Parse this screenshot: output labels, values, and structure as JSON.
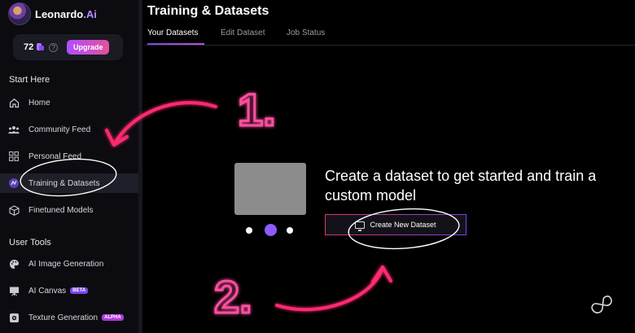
{
  "brand": {
    "name": "Leonardo",
    "suffix": ".Ai"
  },
  "tokens": {
    "count": "72",
    "upgrade_label": "Upgrade"
  },
  "sidebar": {
    "sections": [
      "Start Here",
      "User Tools"
    ],
    "items": [
      {
        "label": "Home",
        "icon": "home-icon"
      },
      {
        "label": "Community Feed",
        "icon": "community-icon"
      },
      {
        "label": "Personal Feed",
        "icon": "grid-icon"
      },
      {
        "label": "Training & Datasets",
        "icon": "training-icon",
        "active": true
      },
      {
        "label": "Finetuned Models",
        "icon": "cube-icon"
      },
      {
        "label": "AI Image Generation",
        "icon": "palette-icon"
      },
      {
        "label": "AI Canvas",
        "icon": "canvas-icon",
        "badge": "BETA"
      },
      {
        "label": "Texture Generation",
        "icon": "texture-icon",
        "badge": "ALPHA"
      }
    ]
  },
  "main": {
    "title": "Training & Datasets",
    "tabs": [
      "Your Datasets",
      "Edit Dataset",
      "Job Status"
    ],
    "active_tab": 0,
    "headline": "Create a dataset to get started and train a custom model",
    "create_button": "Create New Dataset",
    "carousel": {
      "count": 3,
      "active_index": 1
    }
  },
  "annotations": {
    "step1": "1.",
    "step2": "2.",
    "color": "#ff2a6d"
  },
  "colors": {
    "accent": "#8c5bff",
    "upgrade_gradient": [
      "#b24dff",
      "#e0529c"
    ]
  }
}
